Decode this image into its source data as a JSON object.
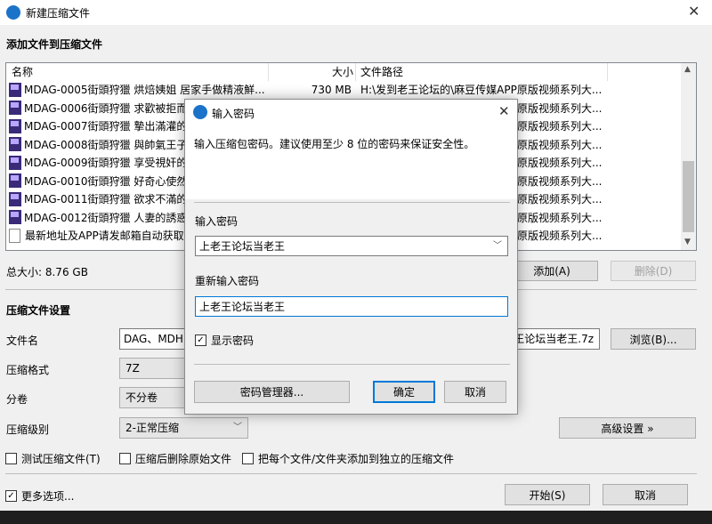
{
  "main": {
    "title": "新建压缩文件",
    "section_add": "添加文件到压缩文件",
    "columns": {
      "name": "名称",
      "size": "大小",
      "path": "文件路径"
    },
    "files": [
      {
        "name": "MDAG-0005街頭狩獵 烘焙姨姐 居家手做精液鮮...",
        "size": "730 MB",
        "path": "H:\\发到老王论坛的\\麻豆传媒APP原版视频系列大...",
        "icon": "mp4"
      },
      {
        "name": "MDAG-0006街頭狩獵 求歡被拒而",
        "size": "",
        "path": "原版视频系列大...",
        "icon": "mp4"
      },
      {
        "name": "MDAG-0007街頭狩獵 摯出滿灌的",
        "size": "",
        "path": "原版视频系列大...",
        "icon": "mp4"
      },
      {
        "name": "MDAG-0008街頭狩獵 與帥氣王子",
        "size": "",
        "path": "原版视频系列大...",
        "icon": "mp4"
      },
      {
        "name": "MDAG-0009街頭狩獵 享受視奸的",
        "size": "",
        "path": "原版视频系列大...",
        "icon": "mp4"
      },
      {
        "name": "MDAG-0010街頭狩獵 好奇心使然",
        "size": "",
        "path": "原版视频系列大...",
        "icon": "mp4"
      },
      {
        "name": "MDAG-0011街頭狩獵 欲求不滿的",
        "size": "",
        "path": "原版视频系列大...",
        "icon": "mp4"
      },
      {
        "name": "MDAG-0012街頭狩獵 人妻的誘惑",
        "size": "",
        "path": "原版视频系列大...",
        "icon": "mp4"
      },
      {
        "name": "最新地址及APP请发邮箱自动获取",
        "size": "",
        "path": "原版视频系列大...",
        "icon": "txt"
      }
    ],
    "total_size": "总大小: 8.76 GB",
    "add_button": "添加(A)",
    "delete_button": "删除(D)",
    "section_settings": "压缩文件设置",
    "filename_label": "文件名",
    "filename_value_left": "DAG、MDH",
    "filename_value_right": "王论坛当老王.7z",
    "browse_button": "浏览(B)...",
    "format_label": "压缩格式",
    "format_value": "7Z",
    "split_label": "分卷",
    "split_value": "不分卷",
    "level_label": "压缩级别",
    "level_value": "2-正常压缩",
    "advanced_button": "高级设置 »",
    "test_checkbox": "测试压缩文件(T)",
    "delete_after_checkbox": "压缩后删除原始文件",
    "each_file_checkbox": "把每个文件/文件夹添加到独立的压缩文件",
    "more_options": "更多选项...",
    "start_button": "开始(S)",
    "cancel_button": "取消"
  },
  "dialog": {
    "title": "输入密码",
    "hint": "输入压缩包密码。建议使用至少 8 位的密码来保证安全性。",
    "password_label": "输入密码",
    "password_value": "上老王论坛当老王",
    "reenter_label": "重新输入密码",
    "reenter_value": "上老王论坛当老王",
    "show_password": "显示密码",
    "manager_button": "密码管理器...",
    "ok_button": "确定",
    "cancel_button": "取消"
  }
}
